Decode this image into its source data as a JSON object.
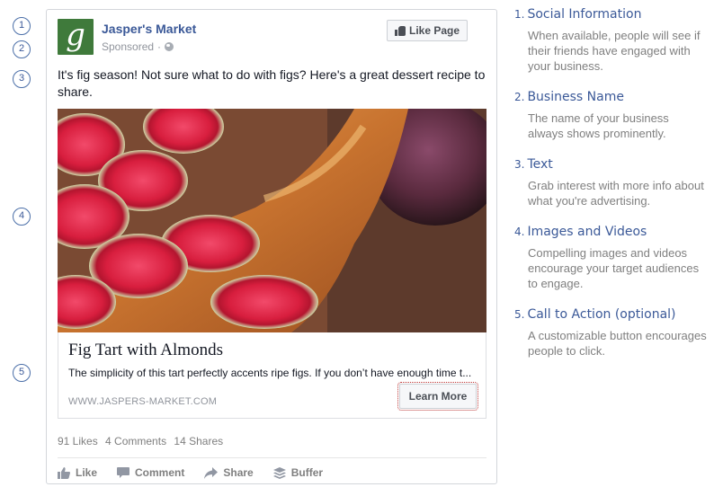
{
  "markers": [
    "1",
    "2",
    "3",
    "4",
    "5"
  ],
  "post": {
    "page_name": "Jasper's Market",
    "sponsored": "Sponsored",
    "dot": "·",
    "like_page": "Like Page",
    "text": "It's fig season! Not sure what to do with figs? Here's a great dessert recipe to share.",
    "logo_letter": "g",
    "link": {
      "title": "Fig Tart with Almonds",
      "description": "The simplicity of this tart perfectly accents ripe figs. If you don’t have enough time t...",
      "url": "WWW.JASPERS-MARKET.COM",
      "cta": "Learn More"
    },
    "stats": {
      "likes": "91 Likes",
      "comments": "4 Comments",
      "shares": "14 Shares"
    },
    "actions": {
      "like": "Like",
      "comment": "Comment",
      "share": "Share",
      "buffer": "Buffer"
    }
  },
  "guide": [
    {
      "num": "1.",
      "title": "Social Information",
      "desc": "When available, people will see if their friends have engaged with your business."
    },
    {
      "num": "2.",
      "title": "Business Name",
      "desc": "The name of your business always shows prominently."
    },
    {
      "num": "3.",
      "title": "Text",
      "desc": "Grab interest with more info about what you're advertising."
    },
    {
      "num": "4.",
      "title": "Images and Videos",
      "desc": "Compelling images and videos encourage your target audiences to engage."
    },
    {
      "num": "5.",
      "title": "Call to Action (optional)",
      "desc": "A customizable button encourages people to click."
    }
  ],
  "colors": {
    "brand_blue": "#3b5998",
    "muted_gray": "#7f7f7f",
    "logo_green": "#3f7a3b"
  },
  "icons": [
    "globe-icon",
    "thumb-icon",
    "like-icon",
    "comment-icon",
    "share-icon",
    "buffer-icon"
  ]
}
